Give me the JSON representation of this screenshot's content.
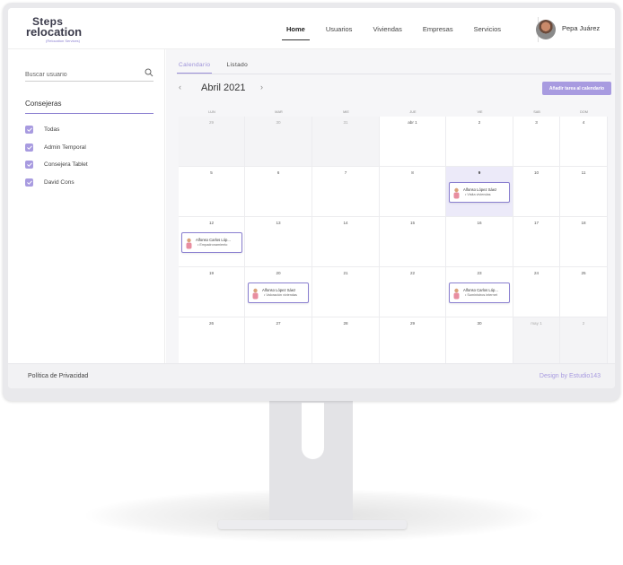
{
  "header": {
    "logo_top": "Steps",
    "logo_main": "relocation",
    "logo_sub": "(Relocation Services)",
    "nav": [
      "Home",
      "Usuarios",
      "Viviendas",
      "Empresas",
      "Servicios"
    ],
    "user_name": "Pepa Juárez"
  },
  "sidebar": {
    "search_placeholder": "Buscar usuario",
    "section_title": "Consejeras",
    "filters": [
      "Todas",
      "Admin Temporal",
      "Consejera Tablet",
      "David Cons"
    ]
  },
  "calendar": {
    "tabs": [
      "Calendario",
      "Listado"
    ],
    "prev_arrow": "‹",
    "next_arrow": "›",
    "month_label": "Abril 2021",
    "add_button": "Añadir tarea al calendario",
    "weekdays": [
      "LUN",
      "MAR",
      "MIE",
      "JUE",
      "VIE",
      "SAB",
      "DOM"
    ],
    "weeks": [
      [
        {
          "d": "29",
          "o": true
        },
        {
          "d": "30",
          "o": true
        },
        {
          "d": "31",
          "o": true
        },
        {
          "d": "abr 1",
          "o": false
        },
        {
          "d": "2",
          "o": false
        },
        {
          "d": "3",
          "o": false
        },
        {
          "d": "4",
          "o": false
        }
      ],
      [
        {
          "d": "5",
          "o": false
        },
        {
          "d": "6",
          "o": false
        },
        {
          "d": "7",
          "o": false
        },
        {
          "d": "8",
          "o": false
        },
        {
          "d": "9",
          "o": false,
          "today": true
        },
        {
          "d": "10",
          "o": false
        },
        {
          "d": "11",
          "o": false
        }
      ],
      [
        {
          "d": "12",
          "o": false
        },
        {
          "d": "13",
          "o": false
        },
        {
          "d": "14",
          "o": false
        },
        {
          "d": "15",
          "o": false
        },
        {
          "d": "16",
          "o": false
        },
        {
          "d": "17",
          "o": false
        },
        {
          "d": "18",
          "o": false
        }
      ],
      [
        {
          "d": "19",
          "o": false
        },
        {
          "d": "20",
          "o": false
        },
        {
          "d": "21",
          "o": false
        },
        {
          "d": "22",
          "o": false
        },
        {
          "d": "23",
          "o": false
        },
        {
          "d": "24",
          "o": false
        },
        {
          "d": "25",
          "o": false
        }
      ],
      [
        {
          "d": "26",
          "o": false
        },
        {
          "d": "27",
          "o": false
        },
        {
          "d": "28",
          "o": false
        },
        {
          "d": "29",
          "o": false
        },
        {
          "d": "30",
          "o": false
        },
        {
          "d": "may 1",
          "o": true
        },
        {
          "d": "2",
          "o": true
        }
      ]
    ],
    "events": [
      {
        "week": 1,
        "day": 4,
        "name": "Alfonso López Sáez",
        "type": "• Visita viviendas"
      },
      {
        "week": 2,
        "day": 0,
        "name": "Alfonso Carlos Lóp...",
        "type": "• Empadronamiento"
      },
      {
        "week": 3,
        "day": 1,
        "name": "Alfonso López Sáez",
        "type": "• Valoración viviendas"
      },
      {
        "week": 3,
        "day": 4,
        "name": "Alfonso Carlos Lóp...",
        "type": "• Suministros internet"
      }
    ]
  },
  "footer": {
    "privacy": "Política de Privacidad",
    "design": "Design by Estudio143"
  },
  "colors": {
    "accent": "#a89be0",
    "accent_dark": "#8a7fd0",
    "today_bg": "#eceaf9"
  }
}
